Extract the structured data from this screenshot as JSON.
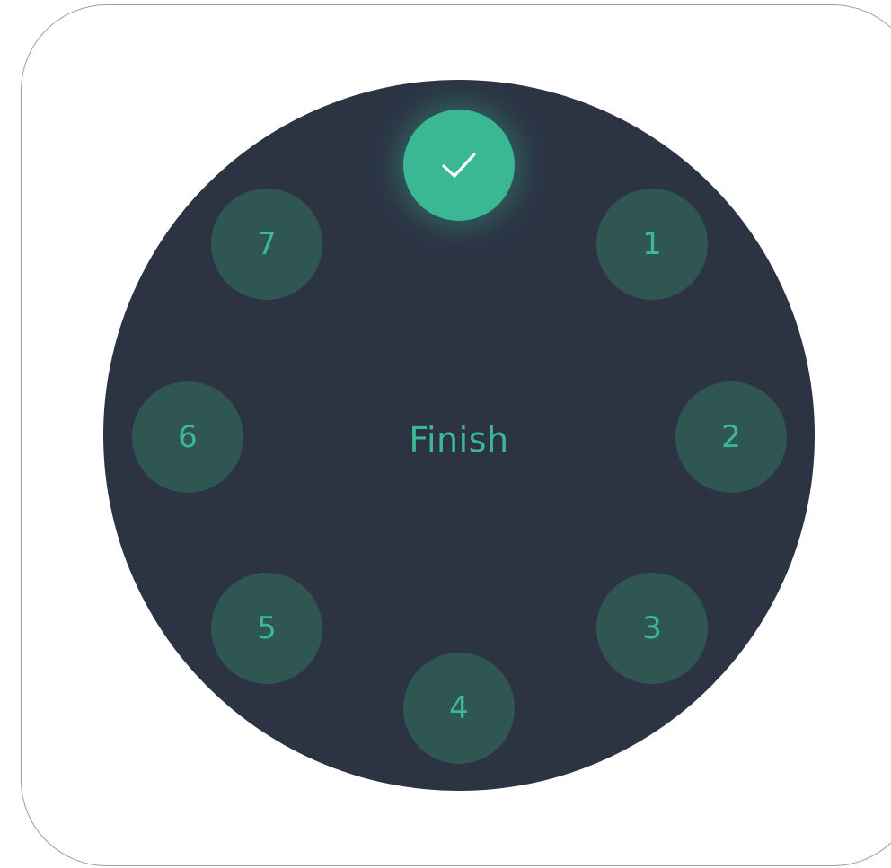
{
  "dial": {
    "center_label": "Finish",
    "steps": [
      {
        "label": "1",
        "state": "pending"
      },
      {
        "label": "2",
        "state": "pending"
      },
      {
        "label": "3",
        "state": "pending"
      },
      {
        "label": "4",
        "state": "pending"
      },
      {
        "label": "5",
        "state": "pending"
      },
      {
        "label": "6",
        "state": "pending"
      },
      {
        "label": "7",
        "state": "pending"
      }
    ],
    "completed_step": {
      "icon": "check-icon",
      "state": "done"
    }
  },
  "colors": {
    "dial_background": "#2c3444",
    "accent": "#3ab894",
    "step_background": "#2f5653",
    "frame_border": "#9a9da3"
  }
}
